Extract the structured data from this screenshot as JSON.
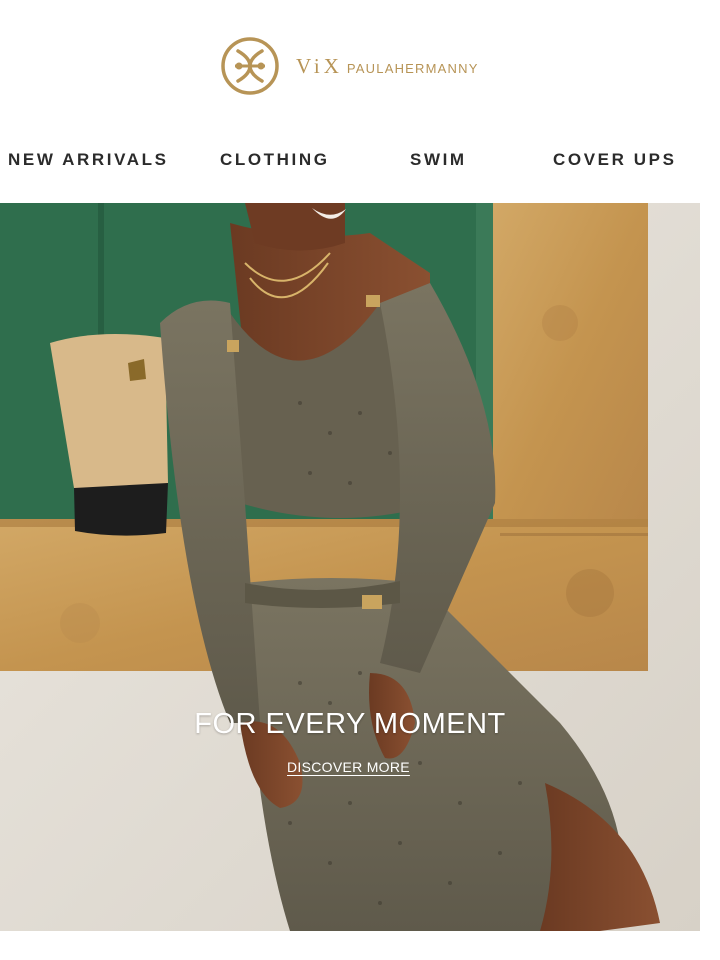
{
  "brand": {
    "logo_icon": "vix-monogram-icon",
    "name_vix": "ViX",
    "name_brand": "PAULAHERMANNY",
    "color": "#b79456"
  },
  "nav": {
    "items": [
      {
        "label": "NEW ARRIVALS"
      },
      {
        "label": "CLOTHING"
      },
      {
        "label": "SWIM"
      },
      {
        "label": "COVER UPS"
      }
    ]
  },
  "hero": {
    "title": "FOR EVERY MOMENT",
    "cta": "DISCOVER MORE"
  }
}
